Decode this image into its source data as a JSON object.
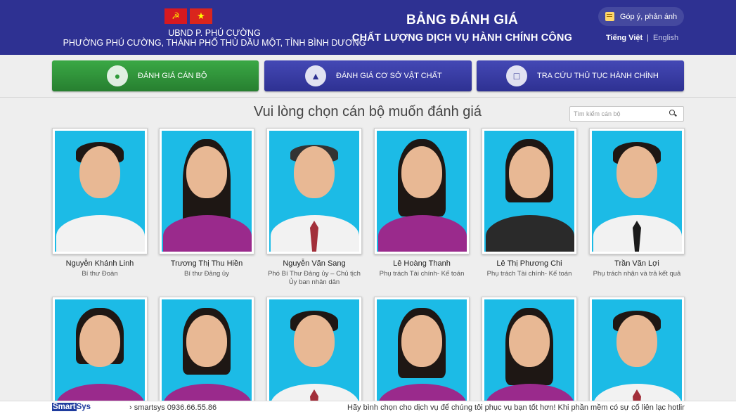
{
  "header": {
    "flag_party_icon": "hammer-sickle-icon",
    "flag_vn_icon": "star-icon",
    "org_line1": "UBND P. PHÚ CƯỜNG",
    "org_line2": "PHƯỜNG PHÚ CƯỜNG, THÀNH PHỐ THỦ DẦU MỘT, TỈNH BÌNH DƯƠNG",
    "title_line1": "BẢNG ĐÁNH GIÁ",
    "title_line2": "CHẤT LƯỢNG DỊCH VỤ HÀNH CHÍNH CÔNG",
    "feedback_label": "Góp ý, phản ánh",
    "lang_vi": "Tiếng Việt",
    "lang_sep": "|",
    "lang_en": "English",
    "bg_color": "#2e3192"
  },
  "nav": [
    {
      "label": "ĐÁNH GIÁ CÁN BỘ",
      "icon": "user-icon",
      "color": "#2f9a3a"
    },
    {
      "label": "ĐÁNH GIÁ CƠ SỞ VẬT CHẤT",
      "icon": "thumbs-up-icon",
      "color": "#2e3192"
    },
    {
      "label": "TRA CỨU THỦ TỤC HÀNH CHÍNH",
      "icon": "document-search-icon",
      "color": "#2e3192"
    }
  ],
  "section": {
    "title": "Vui lòng chọn cán bộ muốn đánh giá",
    "search_placeholder": "Tìm kiếm cán bộ"
  },
  "staff": [
    {
      "name": "Nguyễn Khánh Linh",
      "role": "Bí thư Đoàn"
    },
    {
      "name": "Trương Thị Thu Hiền",
      "role": "Bí thư Đảng ủy"
    },
    {
      "name": "Nguyễn Văn Sang",
      "role": "Phó Bí Thư Đảng ủy – Chủ tịch Ủy ban nhân dân"
    },
    {
      "name": "Lê Hoàng Thanh",
      "role": "Phụ trách Tài chính- Kế toán"
    },
    {
      "name": "Lê Thị Phương Chi",
      "role": "Phụ trách Tài chính- Kế toán"
    },
    {
      "name": "Trần Văn Lợi",
      "role": "Phụ trách nhận và trả kết quả"
    }
  ],
  "footer": {
    "brand_part1": "Smart",
    "brand_part2": "Sys",
    "contact": "› smartsys 0936.66.55.86",
    "marquee": "Hãy bình chọn cho dịch vụ để chúng tôi phục vụ bạn tốt hơn! Khi phần mềm có sự cố liên lạc hotline"
  }
}
